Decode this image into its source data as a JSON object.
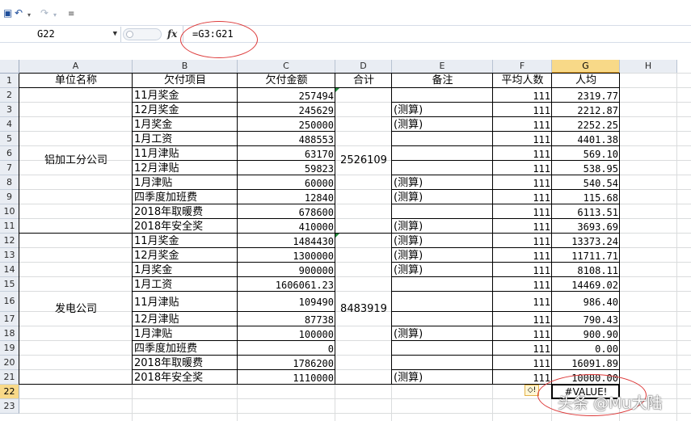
{
  "toolbar": {
    "undo_icon": "undo-icon",
    "redo_icon": "redo-icon",
    "menu_icon": "customize-menu-icon"
  },
  "formula_bar": {
    "name_box": "G22",
    "fx_label": "fx",
    "formula": "=G3:G21"
  },
  "columns": [
    "A",
    "B",
    "C",
    "D",
    "E",
    "F",
    "G",
    "H"
  ],
  "selected_column": "G",
  "selected_row": "22",
  "rows": [
    "1",
    "2",
    "3",
    "4",
    "5",
    "6",
    "7",
    "8",
    "9",
    "10",
    "11",
    "12",
    "13",
    "14",
    "15",
    "16",
    "17",
    "18",
    "19",
    "20",
    "21",
    "22",
    "23"
  ],
  "headers": {
    "a": "单位名称",
    "b": "欠付项目",
    "c": "欠付金额",
    "d": "合计",
    "e": "备注",
    "f": "平均人数",
    "g": "人均"
  },
  "groups": [
    {
      "unit": "铝加工分公司",
      "total": "2526109"
    },
    {
      "unit": "发电公司",
      "total": "8483919"
    }
  ],
  "data": [
    {
      "b": "11月奖金",
      "c": "257494",
      "e": "",
      "f": "111",
      "g": "2319.77"
    },
    {
      "b": "12月奖金",
      "c": "245629",
      "e": "(测算)",
      "f": "111",
      "g": "2212.87"
    },
    {
      "b": "1月奖金",
      "c": "250000",
      "e": "(测算)",
      "f": "111",
      "g": "2252.25"
    },
    {
      "b": "1月工资",
      "c": "488553",
      "e": "",
      "f": "111",
      "g": "4401.38"
    },
    {
      "b": "11月津贴",
      "c": "63170",
      "e": "",
      "f": "111",
      "g": "569.10"
    },
    {
      "b": "12月津贴",
      "c": "59823",
      "e": "",
      "f": "111",
      "g": "538.95"
    },
    {
      "b": "1月津贴",
      "c": "60000",
      "e": "(测算)",
      "f": "111",
      "g": "540.54"
    },
    {
      "b": "四季度加班费",
      "c": "12840",
      "e": "(测算)",
      "f": "111",
      "g": "115.68"
    },
    {
      "b": "2018年取暖费",
      "c": "678600",
      "e": "",
      "f": "111",
      "g": "6113.51"
    },
    {
      "b": "2018年安全奖",
      "c": "410000",
      "e": "(测算)",
      "f": "111",
      "g": "3693.69"
    },
    {
      "b": "11月奖金",
      "c": "1484430",
      "e": "(测算)",
      "f": "111",
      "g": "13373.24"
    },
    {
      "b": "12月奖金",
      "c": "1300000",
      "e": "(测算)",
      "f": "111",
      "g": "11711.71"
    },
    {
      "b": "1月奖金",
      "c": "900000",
      "e": "(测算)",
      "f": "111",
      "g": "8108.11"
    },
    {
      "b": "1月工资",
      "c": "1606061.23",
      "e": "",
      "f": "111",
      "g": "14469.02"
    },
    {
      "b": "11月津贴",
      "c": "109490",
      "e": "",
      "f": "111",
      "g": "986.40"
    },
    {
      "b": "12月津贴",
      "c": "87738",
      "e": "",
      "f": "111",
      "g": "790.43"
    },
    {
      "b": "1月津贴",
      "c": "100000",
      "e": "(测算)",
      "f": "111",
      "g": "900.90"
    },
    {
      "b": "四季度加班费",
      "c": "0",
      "e": "",
      "f": "111",
      "g": "0.00"
    },
    {
      "b": "2018年取暖费",
      "c": "1786200",
      "e": "",
      "f": "111",
      "g": "16091.89"
    },
    {
      "b": "2018年安全奖",
      "c": "1110000",
      "e": "(测算)",
      "f": "111",
      "g": "10000.00"
    }
  ],
  "active_cell_value": "#VALUE!",
  "error_icon": "error-warning-icon",
  "annotation_color": "#dd3a3a",
  "watermark": "头条 @Mu大陆"
}
